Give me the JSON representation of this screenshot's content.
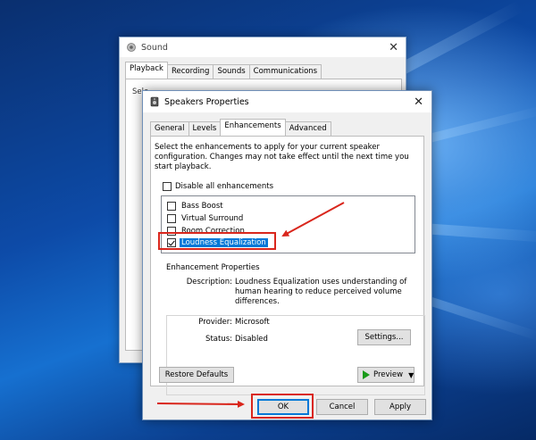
{
  "sound_window": {
    "title": "Sound",
    "close_glyph": "✕",
    "tabs": [
      {
        "label": "Playback",
        "active": true
      },
      {
        "label": "Recording",
        "active": false
      },
      {
        "label": "Sounds",
        "active": false
      },
      {
        "label": "Communications",
        "active": false
      }
    ],
    "partial_text": "Sele"
  },
  "speakers_window": {
    "title": "Speakers Properties",
    "close_glyph": "✕",
    "tabs": [
      {
        "label": "General",
        "active": false
      },
      {
        "label": "Levels",
        "active": false
      },
      {
        "label": "Enhancements",
        "active": true
      },
      {
        "label": "Advanced",
        "active": false
      }
    ],
    "description": "Select the enhancements to apply for your current speaker configuration. Changes may not take effect until the next time you start playback.",
    "disable_all": {
      "label": "Disable all enhancements",
      "checked": false
    },
    "enhancements": [
      {
        "label": "Bass Boost",
        "checked": false,
        "selected": false
      },
      {
        "label": "Virtual Surround",
        "checked": false,
        "selected": false
      },
      {
        "label": "Room Correction",
        "checked": false,
        "selected": false
      },
      {
        "label": "Loudness Equalization",
        "checked": true,
        "selected": true
      }
    ],
    "properties": {
      "group_title": "Enhancement Properties",
      "description_label": "Description:",
      "description_value": "Loudness Equalization uses understanding of human hearing to reduce perceived volume differences.",
      "provider_label": "Provider:",
      "provider_value": "Microsoft",
      "status_label": "Status:",
      "status_value": "Disabled",
      "settings_button": "Settings..."
    },
    "restore_defaults_button": "Restore Defaults",
    "preview_button": "Preview",
    "ok_button": "OK",
    "cancel_button": "Cancel",
    "apply_button": "Apply"
  },
  "colors": {
    "annotation_red": "#d9261c",
    "selection_blue": "#0078d7"
  }
}
